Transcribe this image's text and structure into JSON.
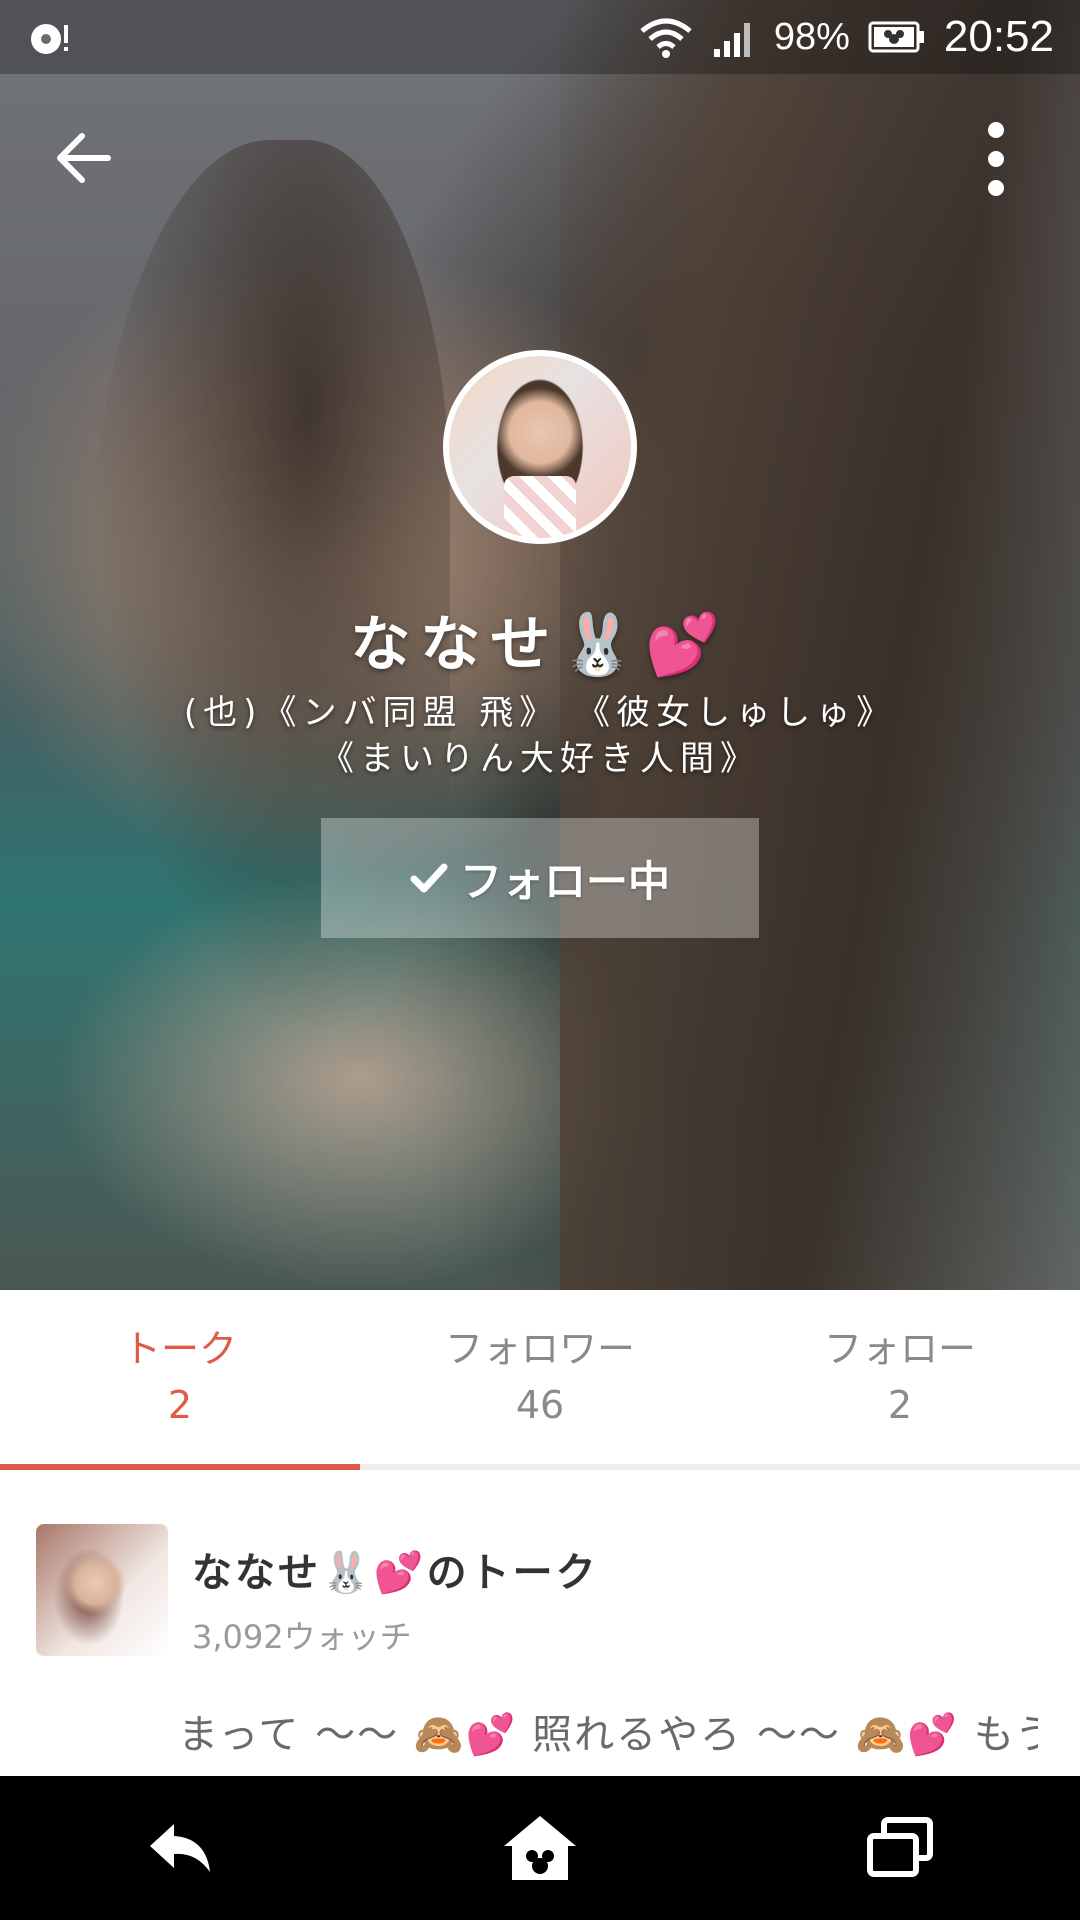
{
  "status_bar": {
    "battery": "98%",
    "time": "20:52"
  },
  "profile": {
    "name": "ななせ🐰💕",
    "bio_line1": "(也)《ンバ同盟 飛》 《彼女しゅしゅ》",
    "bio_line2": "《まいりん大好き人間》",
    "follow_button_label": "フォロー中"
  },
  "tabs": [
    {
      "label": "トーク",
      "count": "2"
    },
    {
      "label": "フォロワー",
      "count": "46"
    },
    {
      "label": "フォロー",
      "count": "2"
    }
  ],
  "talk": {
    "title": "ななせ🐰💕のトーク",
    "watch_count": "3,092ウォッチ",
    "preview": "まって ～～ 🙈💕 照れるやろ ～～ 🙈💕 もう…"
  },
  "colors": {
    "accent": "#e05a47"
  }
}
